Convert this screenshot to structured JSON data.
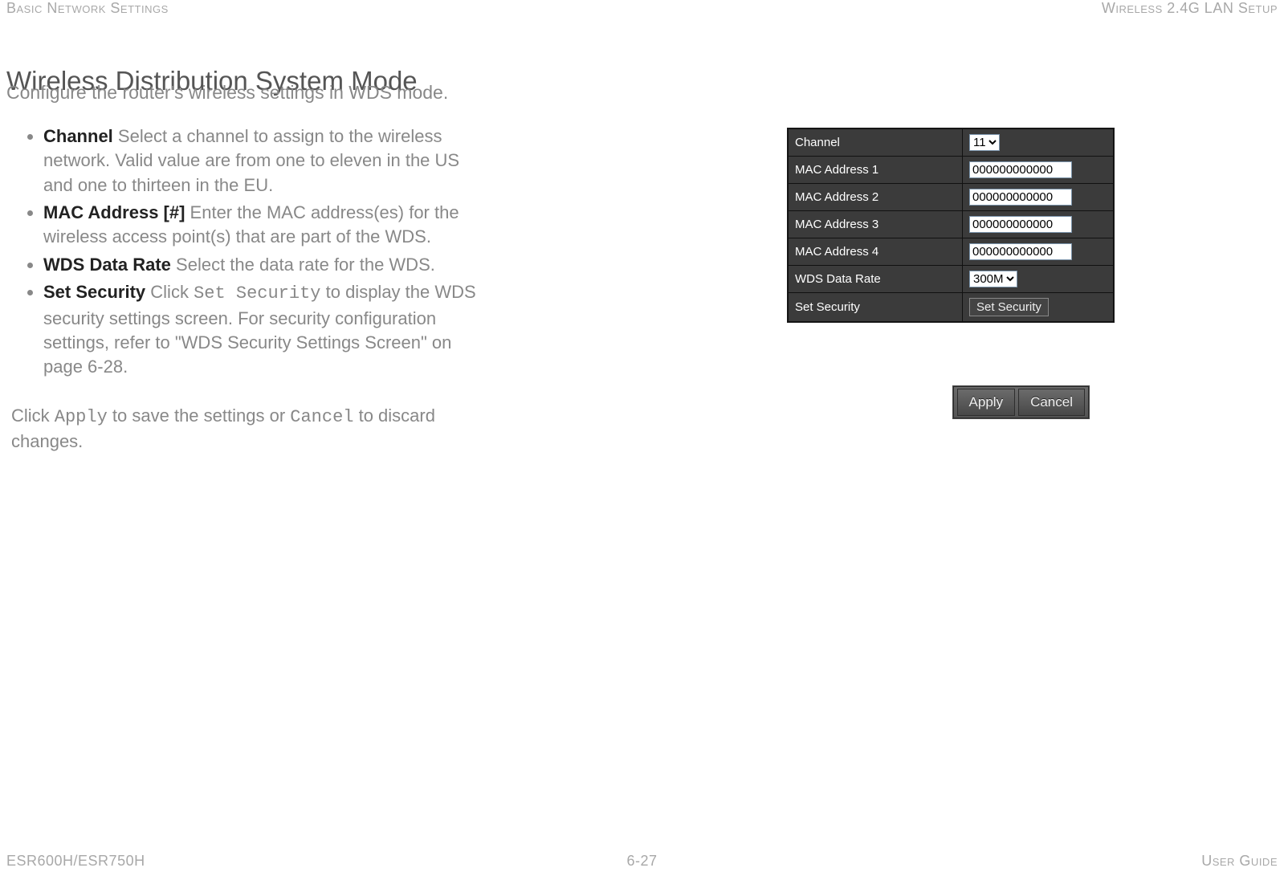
{
  "header": {
    "left": "Basic Network Settings",
    "right": "Wireless 2.4G LAN Setup"
  },
  "title": "Wireless Distribution System Mode",
  "subtitle": "Configure the router's wireless settings in WDS mode.",
  "bullets": {
    "channel_term": "Channel",
    "channel_desc": "  Select a channel to assign to the wireless network. Valid value are from one to eleven in the US and one to thirteen in the EU.",
    "mac_term": "MAC Address [#]",
    "mac_desc": "  Enter the MAC address(es) for the wireless access point(s) that are part of the WDS.",
    "wds_term": "WDS Data Rate",
    "wds_desc": "  Select the data rate for the WDS.",
    "sec_term": "Set Security",
    "sec_pre": "  Click ",
    "sec_code": "Set Security",
    "sec_post": " to display the WDS security settings screen. For security configuration settings, refer to \"WDS Security Settings Screen\" on page 6-28."
  },
  "apply_para": {
    "pre": "Click ",
    "apply": "Apply",
    "mid": " to save the settings or ",
    "cancel": "Cancel",
    "post": " to discard changes."
  },
  "table": {
    "channel_label": "Channel",
    "channel_value": "11",
    "mac1_label": "MAC Address 1",
    "mac1_value": "000000000000",
    "mac2_label": "MAC Address 2",
    "mac2_value": "000000000000",
    "mac3_label": "MAC Address 3",
    "mac3_value": "000000000000",
    "mac4_label": "MAC Address 4",
    "mac4_value": "000000000000",
    "wds_label": "WDS Data Rate",
    "wds_value": "300M",
    "sec_label": "Set Security",
    "sec_button": "Set Security"
  },
  "buttons": {
    "apply": "Apply",
    "cancel": "Cancel"
  },
  "footer": {
    "left": "ESR600H/ESR750H",
    "center": "6-27",
    "right": "User Guide"
  }
}
